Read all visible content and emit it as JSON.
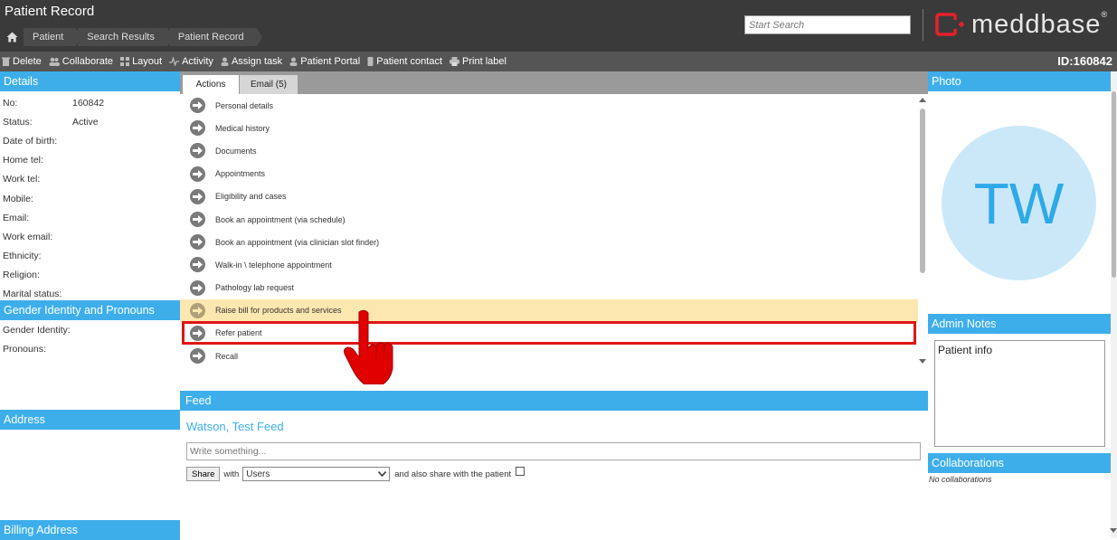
{
  "header": {
    "title": "Patient Record",
    "breadcrumbs": [
      "Patient",
      "Search Results",
      "Patient Record"
    ],
    "search_placeholder": "Start Search",
    "logo_text": "meddbase",
    "logo_mark": "®",
    "brand_color": "#e8202a"
  },
  "toolbar": {
    "items": [
      {
        "label": "Delete",
        "icon": "trash-icon"
      },
      {
        "label": "Collaborate",
        "icon": "users-icon"
      },
      {
        "label": "Layout",
        "icon": "grid-icon"
      },
      {
        "label": "Activity",
        "icon": "pulse-icon"
      },
      {
        "label": "Assign task",
        "icon": "user-icon"
      },
      {
        "label": "Patient Portal",
        "icon": "user-icon"
      },
      {
        "label": "Patient contact",
        "icon": "phone-icon"
      },
      {
        "label": "Print label",
        "icon": "printer-icon"
      }
    ],
    "id_text": "ID:160842"
  },
  "details": {
    "title": "Details",
    "rows": [
      {
        "label": "No:",
        "value": "160842"
      },
      {
        "label": "Status:",
        "value": "Active"
      },
      {
        "label": "Date of birth:",
        "value": ""
      },
      {
        "label": "Home tel:",
        "value": ""
      },
      {
        "label": "Work tel:",
        "value": ""
      },
      {
        "label": "Mobile:",
        "value": ""
      },
      {
        "label": "Email:",
        "value": ""
      },
      {
        "label": "Work email:",
        "value": ""
      },
      {
        "label": "Ethnicity:",
        "value": ""
      },
      {
        "label": "Religion:",
        "value": ""
      },
      {
        "label": "Marital status:",
        "value": ""
      }
    ]
  },
  "gender": {
    "title": "Gender Identity and Pronouns",
    "rows": [
      {
        "label": "Gender Identity:",
        "value": ""
      },
      {
        "label": "Pronouns:",
        "value": ""
      }
    ]
  },
  "address": {
    "title": "Address"
  },
  "billing": {
    "title": "Billing Address"
  },
  "tabs": [
    {
      "label": "Actions",
      "active": true
    },
    {
      "label": "Email (5)",
      "active": false
    }
  ],
  "actions": [
    "Personal details",
    "Medical history",
    "Documents",
    "Appointments",
    "Eligibility and cases",
    "Book an appointment (via schedule)",
    "Book an appointment (via clinician slot finder)",
    "Walk-in \\ telephone appointment",
    "Pathology lab request",
    "Raise bill for products and services",
    "Refer patient",
    "Recall"
  ],
  "highlighted_action": "Raise bill for products and services",
  "feed": {
    "title": "Feed",
    "patient_name": "Watson, Test Feed",
    "input_placeholder": "Write something...",
    "share_button": "Share",
    "with_label": "with",
    "with_value": "Users",
    "also_share_label": "and also share with the patient",
    "share_with_patient": false
  },
  "photo": {
    "title": "Photo",
    "initials": "TW"
  },
  "admin_notes": {
    "title": "Admin Notes",
    "text": "Patient info"
  },
  "collaborations": {
    "title": "Collaborations",
    "empty_text": "No collaborations"
  },
  "colors": {
    "section_blue": "#3daeea",
    "highlight": "#fde7b0",
    "highlight_border": "#e01515",
    "header_bg": "#3a3a3a"
  }
}
